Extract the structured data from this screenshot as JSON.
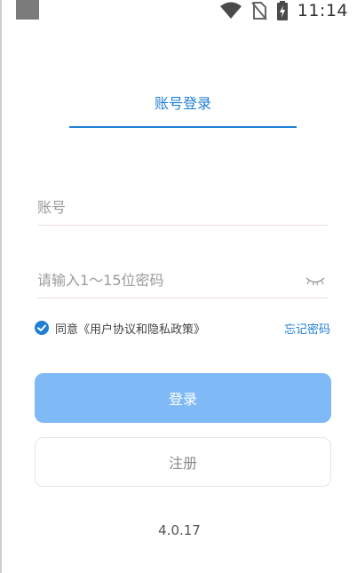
{
  "status_bar": {
    "time": "11:14",
    "icons": [
      "notification-square-icon",
      "wifi-icon",
      "no-sim-icon",
      "battery-charging-icon"
    ]
  },
  "tabs": [
    {
      "label": "账号登录",
      "active": true
    }
  ],
  "form": {
    "account_placeholder": "账号",
    "password_placeholder": "请输入1～15位密码",
    "password_toggle_icon": "eye-closed-icon"
  },
  "agreement": {
    "checked": true,
    "text": "同意《用户协议和隐私政策》",
    "forgot_label": "忘记密码"
  },
  "buttons": {
    "login_label": "登录",
    "register_label": "注册"
  },
  "version": "4.0.17",
  "colors": {
    "accent": "#1f7fd6",
    "login_button": "#7fbaf6",
    "check": "#1f7fd6"
  }
}
